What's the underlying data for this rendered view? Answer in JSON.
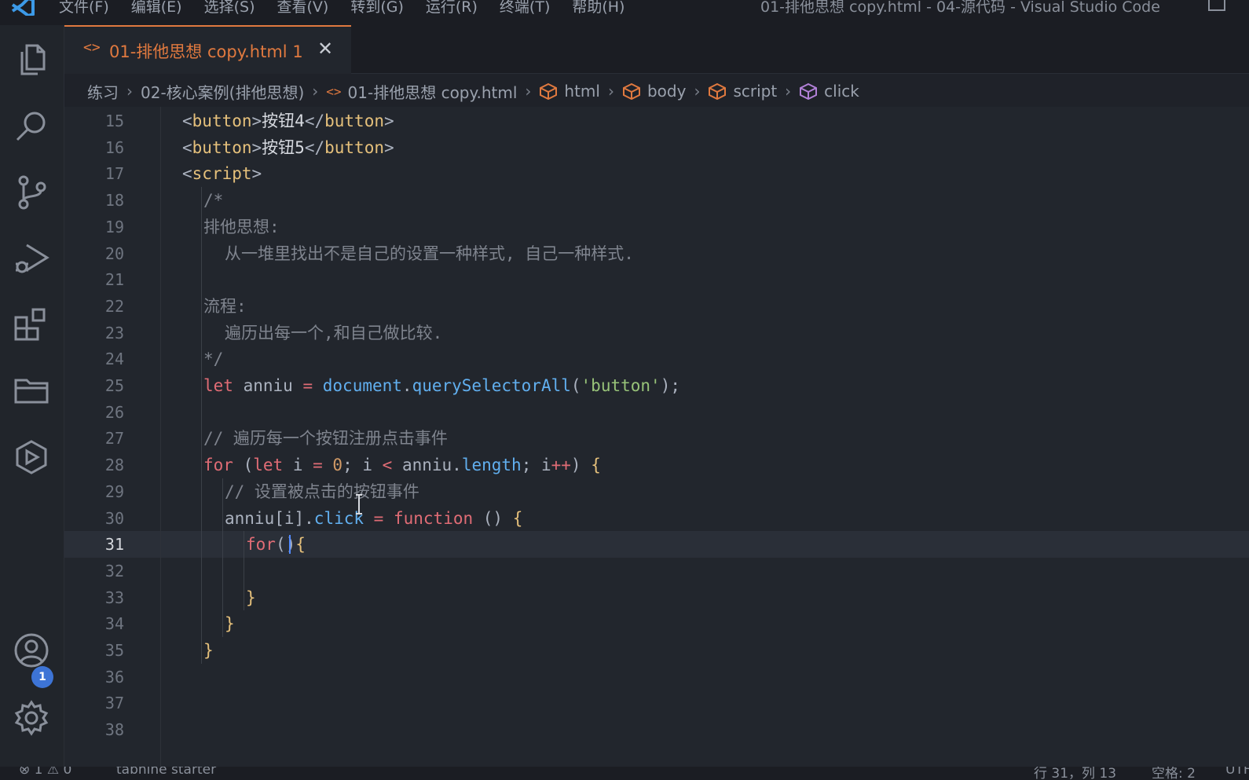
{
  "menu": [
    "文件(F)",
    "编辑(E)",
    "选择(S)",
    "查看(V)",
    "转到(G)",
    "运行(R)",
    "终端(T)",
    "帮助(H)"
  ],
  "window_title": "01-排他思想 copy.html - 04-源代码 - Visual Studio Code",
  "tab": {
    "icon": "<>",
    "label": "01-排他思想 copy.html 1",
    "close": "✕"
  },
  "breadcrumb": {
    "folder1": "练习",
    "folder2": "02-核心案例(排他思想)",
    "file": "01-排他思想 copy.html",
    "html": "html",
    "body": "body",
    "script": "script",
    "symbol": "click",
    "sep": "›"
  },
  "activity": {
    "badge": "1"
  },
  "editor": {
    "current_line": 31,
    "lines": [
      {
        "n": "15",
        "text": "<button>按钮4</button>"
      },
      {
        "n": "16",
        "text": "<button>按钮5</button>"
      },
      {
        "n": "17",
        "text": "<script>"
      },
      {
        "n": "18",
        "text": "/*"
      },
      {
        "n": "19",
        "text": "排他思想:"
      },
      {
        "n": "20",
        "text": "从一堆里找出不是自己的设置一种样式, 自己一种样式."
      },
      {
        "n": "21",
        "text": ""
      },
      {
        "n": "22",
        "text": "流程:"
      },
      {
        "n": "23",
        "text": "遍历出每一个,和自己做比较."
      },
      {
        "n": "24",
        "text": "*/"
      },
      {
        "n": "25",
        "text": "let anniu = document.querySelectorAll('button');"
      },
      {
        "n": "26",
        "text": ""
      },
      {
        "n": "27",
        "text": "// 遍历每一个按钮注册点击事件"
      },
      {
        "n": "28",
        "text": "for (let i = 0; i < anniu.length; i++) {"
      },
      {
        "n": "29",
        "text": "// 设置被点击的按钮事件"
      },
      {
        "n": "30",
        "text": "anniu[i].click = function () {"
      },
      {
        "n": "31",
        "text": "for(){"
      },
      {
        "n": "32",
        "text": ""
      },
      {
        "n": "33",
        "text": "}"
      },
      {
        "n": "34",
        "text": "}"
      },
      {
        "n": "35",
        "text": "}"
      },
      {
        "n": "36",
        "text": ""
      },
      {
        "n": "37",
        "text": ""
      },
      {
        "n": "38",
        "text": ""
      }
    ]
  },
  "status": {
    "problems": "⊗ 1 ⚠ 0",
    "tabnine": "tabnine starter",
    "position": "行 31，列 13",
    "spaces": "空格: 2",
    "encoding": "UTF"
  }
}
